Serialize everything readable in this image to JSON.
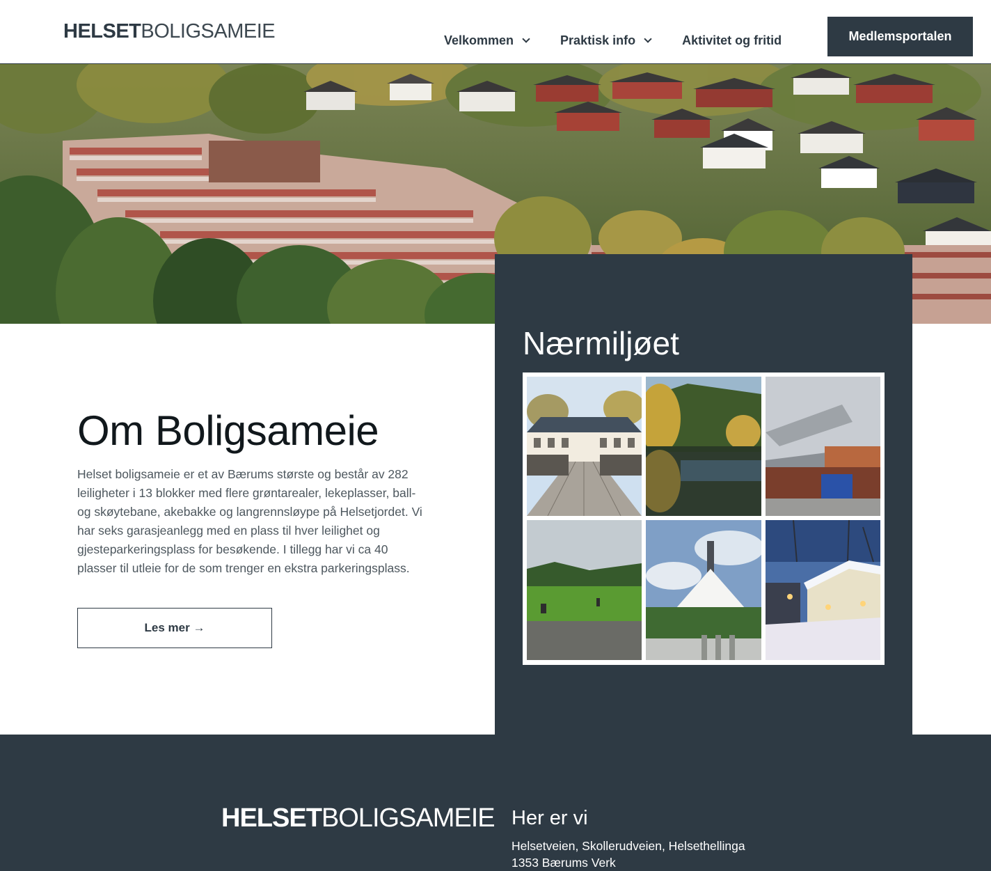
{
  "header": {
    "logo_bold": "HELSET",
    "logo_light": "BOLIGSAMEIE",
    "nav": [
      {
        "label": "Velkommen",
        "has_dropdown": true
      },
      {
        "label": "Praktisk info",
        "has_dropdown": true
      },
      {
        "label": "Aktivitet og fritid",
        "has_dropdown": false
      }
    ],
    "portal_button": "Medlemsportalen"
  },
  "about": {
    "title": "Om Boligsameie",
    "text": "Helset boligsameie er et av Bærums største og består av 282 leiligheter i 13 blokker med flere grøntarealer, lekeplasser, ball- og skøytebane, akebakke og langrennsløype på Helsetjordet. Vi har seks garasjeanlegg med en plass til hver leilighet og gjesteparkeringsplass for besøkende. I tillegg har vi ca 40 plasser til utleie for de som trenger en ekstra parkeringsplass.",
    "read_more": "Les mer →"
  },
  "naermiljo": {
    "title": "Nærmiljøet",
    "tiles": [
      "manor-pier",
      "forest-lake",
      "culture-building",
      "golf-course",
      "white-church",
      "winter-street"
    ]
  },
  "footer": {
    "logo_bold": "HELSET",
    "logo_light": "BOLIGSAMEIE",
    "heading": "Her er vi",
    "address_line1": "Helsetveien, Skollerudveien, Helsethellinga",
    "address_line2": "1353 Bærums Verk"
  },
  "colors": {
    "dark": "#2e3a44",
    "white": "#ffffff",
    "text": "#4d575e"
  }
}
